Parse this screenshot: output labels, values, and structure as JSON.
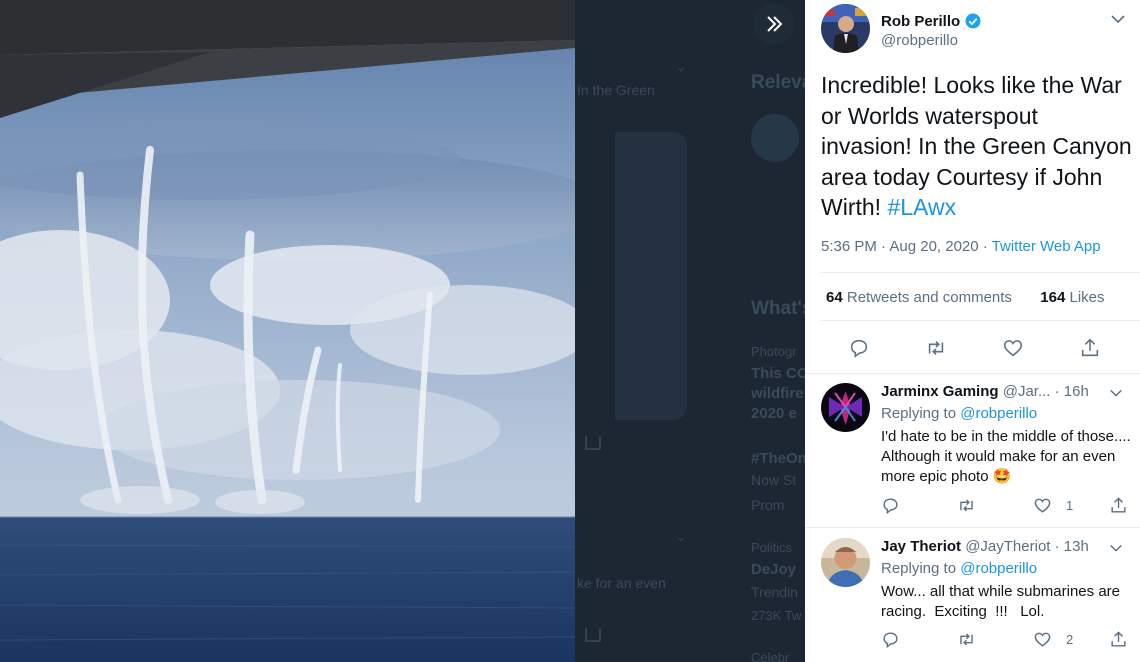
{
  "tweet": {
    "author_name": "Rob Perillo",
    "author_handle": "@robperillo",
    "text_main": "Incredible! Looks like the War or Worlds waterspout invasion! In the Green Canyon area today Courtesy if John Wirth! ",
    "hashtag": "#LAwx",
    "time": "5:36 PM · Aug 20, 2020 · ",
    "source": "Twitter Web App",
    "retweets_count": "64",
    "retweets_label": " Retweets and comments",
    "likes_count": "164",
    "likes_label": " Likes"
  },
  "replies": [
    {
      "name": "Jarminx Gaming",
      "handle": " @Jar...",
      "time": " · 16h",
      "replying_prefix": "Replying to ",
      "replying_to": "@robperillo",
      "text": "I'd hate to be in the middle of those.... Although it would make for an even more epic photo 🤩",
      "likes": "1",
      "retweets": ""
    },
    {
      "name": "Jay Theriot",
      "handle": " @JayTheriot",
      "time": " · 13h",
      "replying_prefix": "Replying to ",
      "replying_to": "@robperillo",
      "text": "Wow... all that while submarines are racing.  Exciting  !!!   Lol.",
      "likes": "2",
      "retweets": ""
    }
  ],
  "background": {
    "heading_relevant": "Releva",
    "snippet_green": "In the Green",
    "heading_whats": "What's",
    "label_photo": "Photogr",
    "bold_this": "This CO",
    "bold_wildfire": "wildfire",
    "bold_2020": "2020 e",
    "hashtag_theone": "#TheOn",
    "now_st": "Now St",
    "promo": "Prom",
    "label_politics": "Politics",
    "bold_dejoy": "DeJoy",
    "trending": "Trendin",
    "count": "273K Tw",
    "snippet_even": "ke for an even",
    "label_celeb": "Celebr"
  },
  "icons": {
    "expand": "double-chevron-right-icon",
    "verified": "verified-badge-icon",
    "more": "chevron-down-icon",
    "reply": "reply-icon",
    "retweet": "retweet-icon",
    "like": "heart-icon",
    "share": "share-icon"
  },
  "colors": {
    "accent": "#1b95e0",
    "text": "#0f1419",
    "secondary": "#5b7083",
    "overlay": "#15202b"
  }
}
